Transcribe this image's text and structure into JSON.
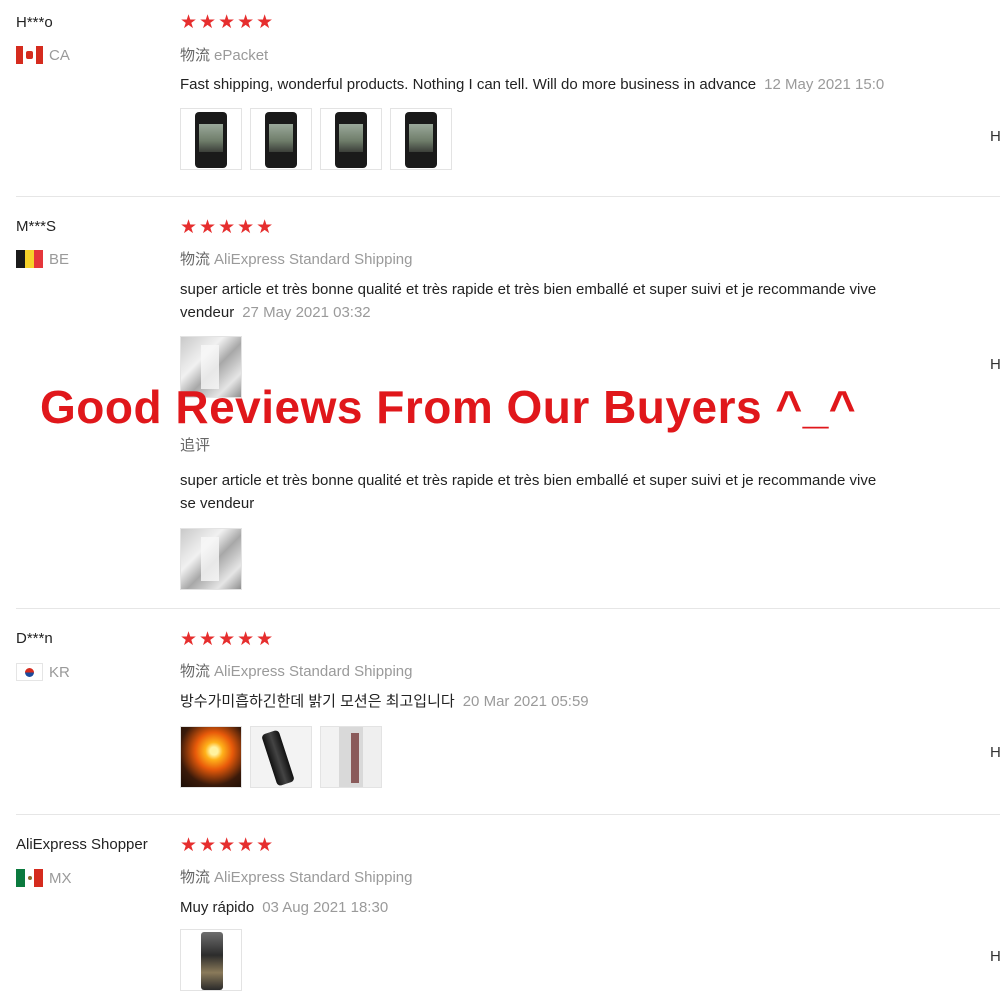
{
  "overlay_title": "Good Reviews From Our Buyers ^_^",
  "colors": {
    "star": "#e62e2e",
    "overlay": "#e0171b",
    "muted": "#9a9a9a"
  },
  "reviews": [
    {
      "user": "H***o",
      "country": "CA",
      "stars": "★★★★★",
      "logistics_label": "物流",
      "logistics": "ePacket",
      "text": "Fast shipping, wonderful products. Nothing I can tell. Will do more business in advance",
      "date": "12 May 2021 15:0",
      "helpful": "H",
      "photos": [
        "phone-photo",
        "phone-photo",
        "phone-photo",
        "phone-photo"
      ]
    },
    {
      "user": "M***S",
      "country": "BE",
      "stars": "★★★★★",
      "logistics_label": "物流",
      "logistics": "AliExpress Standard Shipping",
      "text_line1": "super article et très bonne qualité et très rapide et très bien emballé et super suivi et je recommande vive",
      "text_line2": "vendeur",
      "date": "27 May 2021 03:32",
      "helpful": "H",
      "photos": [
        "room-photo"
      ],
      "followup_label": "追评",
      "followup_line1": "super article et très bonne qualité et très rapide et très bien emballé et super suivi et je recommande vive",
      "followup_line2": "se vendeur",
      "followup_photos": [
        "room-photo"
      ]
    },
    {
      "user": "D***n",
      "country": "KR",
      "stars": "★★★★★",
      "logistics_label": "物流",
      "logistics": "AliExpress Standard Shipping",
      "text": "방수가미흡하긴한데 밝기 모션은 최고입니다",
      "date": "20 Mar 2021 05:59",
      "helpful": "H",
      "photos": [
        "flame-photo",
        "torch-photo",
        "shelf-photo"
      ]
    },
    {
      "user": "AliExpress Shopper",
      "country": "MX",
      "stars": "★★★★★",
      "logistics_label": "物流",
      "logistics": "AliExpress Standard Shipping",
      "text": "Muy rápido",
      "date": "03 Aug 2021 18:30",
      "helpful": "H",
      "photos": [
        "torch-photo"
      ]
    }
  ]
}
